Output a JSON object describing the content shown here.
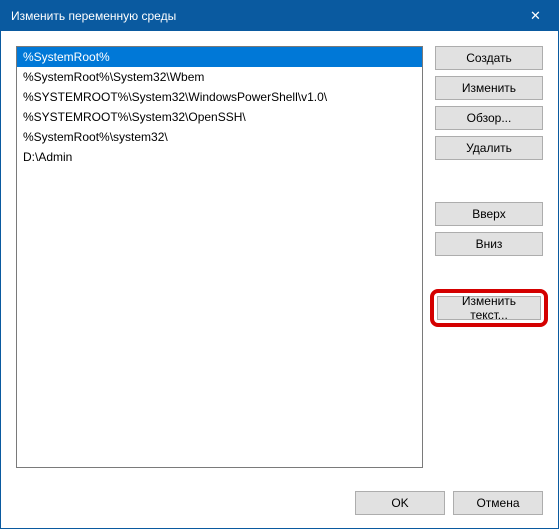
{
  "titlebar": {
    "title": "Изменить переменную среды",
    "close": "✕"
  },
  "list": {
    "items": [
      "%SystemRoot%",
      "%SystemRoot%\\System32\\Wbem",
      "%SYSTEMROOT%\\System32\\WindowsPowerShell\\v1.0\\",
      "%SYSTEMROOT%\\System32\\OpenSSH\\",
      "%SystemRoot%\\system32\\",
      "D:\\Admin"
    ],
    "selected_index": 0
  },
  "buttons": {
    "create": "Создать",
    "edit": "Изменить",
    "browse": "Обзор...",
    "delete": "Удалить",
    "up": "Вверх",
    "down": "Вниз",
    "edit_text": "Изменить текст..."
  },
  "footer": {
    "ok": "OK",
    "cancel": "Отмена"
  }
}
